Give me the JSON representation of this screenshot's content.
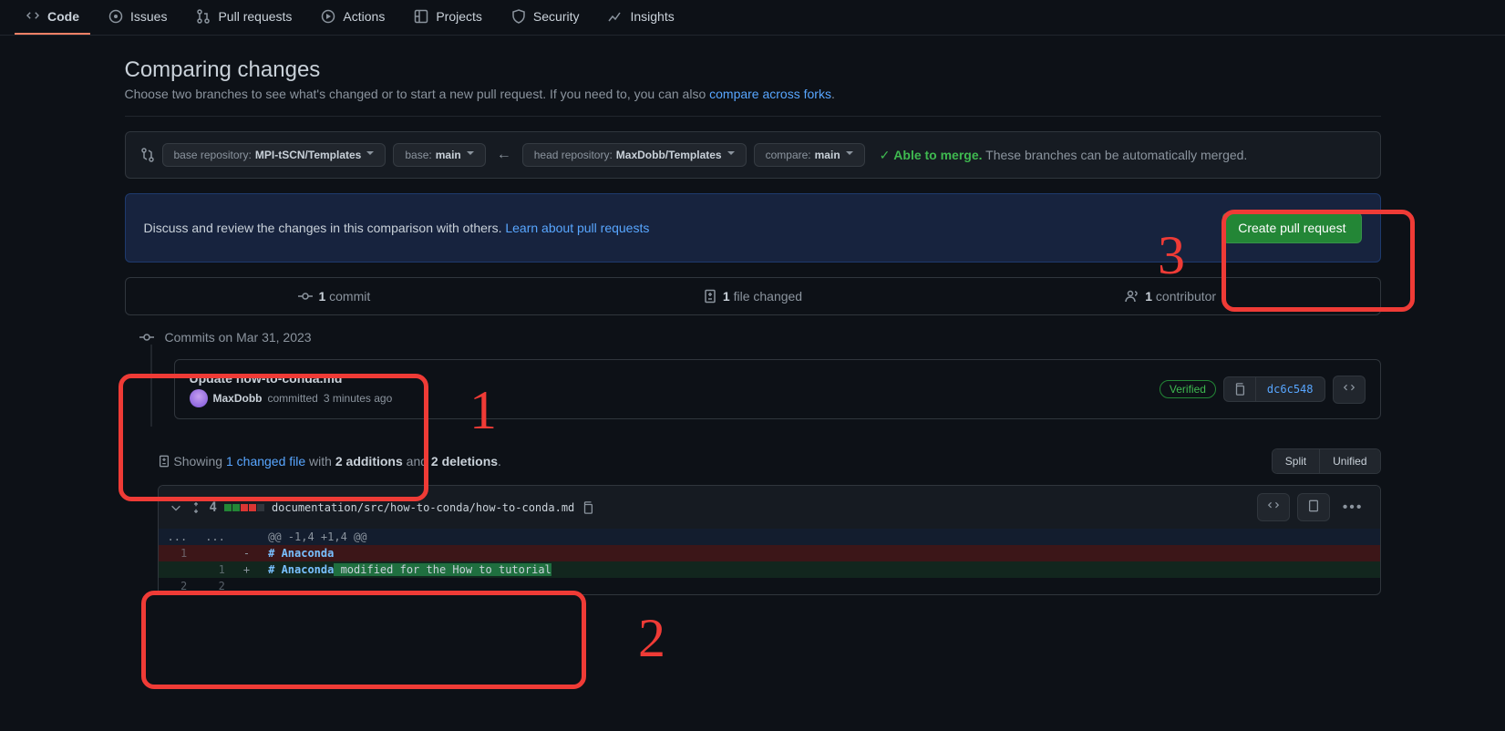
{
  "nav": {
    "code": "Code",
    "issues": "Issues",
    "pulls": "Pull requests",
    "actions": "Actions",
    "projects": "Projects",
    "security": "Security",
    "insights": "Insights"
  },
  "page": {
    "title": "Comparing changes",
    "subtitle_pre": "Choose two branches to see what's changed or to start a new pull request. If you need to, you can also ",
    "subtitle_link": "compare across forks",
    "subtitle_post": "."
  },
  "compare": {
    "base_repo_label": "base repository: ",
    "base_repo": "MPI-tSCN/Templates",
    "base_label": "base: ",
    "base": "main",
    "head_repo_label": "head repository: ",
    "head_repo": "MaxDobb/Templates",
    "compare_label": "compare: ",
    "compare": "main",
    "able": "Able to merge.",
    "auto": " These branches can be automatically merged."
  },
  "pr_banner": {
    "text": "Discuss and review the changes in this comparison with others. ",
    "link": "Learn about pull requests",
    "button": "Create pull request"
  },
  "stats": {
    "commits_n": "1",
    "commits_l": " commit",
    "files_n": "1",
    "files_l": " file changed",
    "contrib_n": "1",
    "contrib_l": " contributor"
  },
  "commits": {
    "date_header": "Commits on Mar 31, 2023",
    "items": [
      {
        "title": "Update how-to-conda.md",
        "author": "MaxDobb",
        "committed": " committed ",
        "time": "3 minutes ago",
        "verified": "Verified",
        "sha": "dc6c548"
      }
    ]
  },
  "file_summary": {
    "showing": "Showing ",
    "link": "1 changed file",
    "with": " with ",
    "adds": "2 additions",
    "and": " and ",
    "dels": "2 deletions",
    "end": ".",
    "split": "Split",
    "unified": "Unified"
  },
  "diff": {
    "count": "4",
    "path": "documentation/src/how-to-conda/how-to-conda.md",
    "hunk": "@@ -1,4 +1,4 @@",
    "l1_old": "1",
    "l1_code_hash": "# ",
    "l1_code_txt": "Anaconda",
    "l2_new": "1",
    "l2_code_hash": "# ",
    "l2_code_txt": "Anaconda",
    "l2_hl": " modified for the How to tutorial",
    "l3_old": "2",
    "l3_new": "2",
    "ellipsis": "..."
  },
  "annotations": {
    "n1": "1",
    "n2": "2",
    "n3": "3"
  }
}
